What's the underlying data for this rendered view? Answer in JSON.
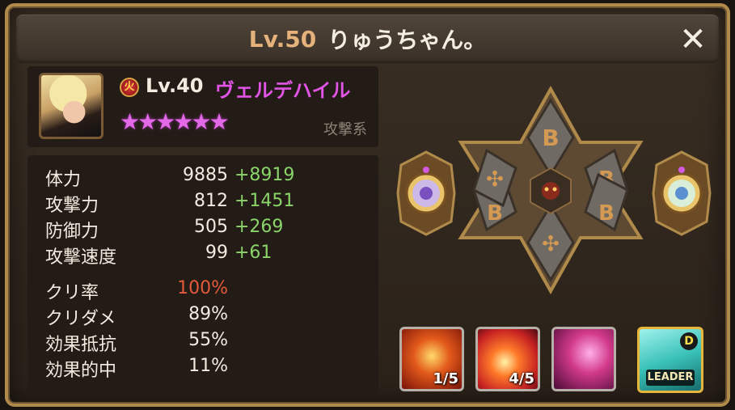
{
  "header": {
    "level": "Lv.50",
    "player_name": "りゅうちゃん。",
    "close_glyph": "✕"
  },
  "monster": {
    "level": "Lv.40",
    "name": "ヴェルデハイル",
    "stars": "★★★★★★",
    "type": "攻撃系",
    "element_glyph": "火"
  },
  "stats": [
    {
      "label": "体力",
      "value": "9885",
      "bonus": "+8919"
    },
    {
      "label": "攻撃力",
      "value": "812",
      "bonus": "+1451"
    },
    {
      "label": "防御力",
      "value": "505",
      "bonus": "+269"
    },
    {
      "label": "攻撃速度",
      "value": "99",
      "bonus": "+61"
    }
  ],
  "sub_stats": [
    {
      "label": "クリ率",
      "value": "100%"
    },
    {
      "label": "クリダメ",
      "value": "89%"
    },
    {
      "label": "効果抵抗",
      "value": "55%"
    },
    {
      "label": "効果的中",
      "value": "11%"
    }
  ],
  "runes": [
    "B",
    "B",
    "B",
    "✣",
    "B",
    "✣"
  ],
  "skills": [
    {
      "level": "1/5"
    },
    {
      "level": "4/5"
    },
    {
      "level": ""
    },
    {
      "tag": "LEADER",
      "badge": "D"
    }
  ],
  "colors": {
    "frame": "#b08a4a",
    "stars": "#e36ae6",
    "bonus": "#8bd46a",
    "crit": "#e25a3a",
    "name": "#e154e6"
  }
}
